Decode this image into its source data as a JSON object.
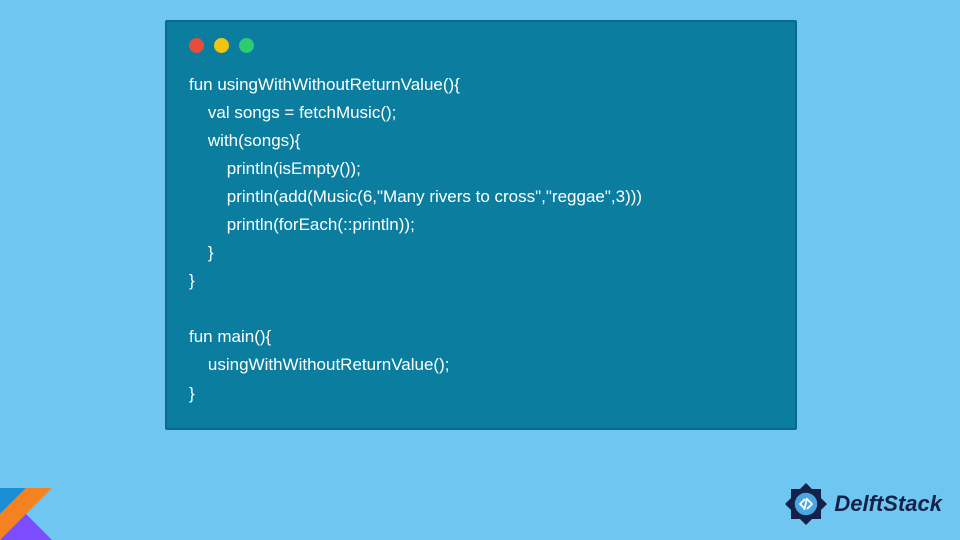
{
  "code": {
    "lines": [
      "fun usingWithWithoutReturnValue(){",
      "    val songs = fetchMusic();",
      "    with(songs){",
      "        println(isEmpty());",
      "        println(add(Music(6,\"Many rivers to cross\",\"reggae\",3)))",
      "        println(forEach(::println));",
      "    }",
      "}",
      "",
      "fun main(){",
      "    usingWithWithoutReturnValue();",
      "}"
    ]
  },
  "brand": {
    "name": "DelftStack"
  },
  "colors": {
    "background": "#6fc6f0",
    "window": "#0b7ea0",
    "brandText": "#14214b"
  }
}
